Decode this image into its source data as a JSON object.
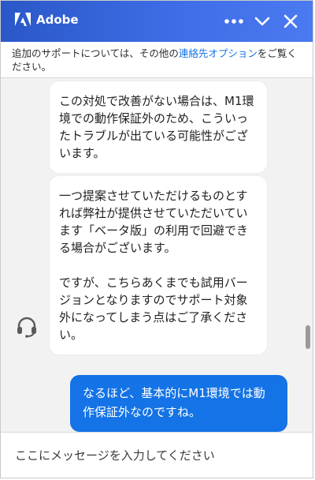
{
  "header": {
    "brand": "Adobe",
    "icons": {
      "logo": "adobe-logo-icon",
      "more": "more-horizontal-icon",
      "minimize": "chevron-down-icon",
      "close": "close-icon"
    }
  },
  "notice": {
    "text_before": "追加のサポートについては、その他の",
    "link": "連絡先オプション",
    "text_after": "をご覧ください。"
  },
  "messages": [
    {
      "role": "agent",
      "paragraphs": [
        "この対処で改善がない場合は、M1環境での動作保証外のため、こういったトラブルが出ている可能性がございます。"
      ]
    },
    {
      "role": "agent",
      "paragraphs": [
        "一つ提案させていただけるものとすれば弊社が提供させていただいています「ベータ版」の利用で回避できる場合がございます。",
        "ですが、こちらあくまでも試用バージョンとなりますのでサポート対象外になってしまう点はご了承ください。"
      ]
    },
    {
      "role": "user",
      "paragraphs": [
        "なるほど、基本的にM1環境では動作保証外なのですね。"
      ]
    }
  ],
  "composer": {
    "placeholder": "ここにメッセージを入力してください"
  },
  "colors": {
    "header": "#3b68e0",
    "accent": "#1473e6",
    "background": "#f2f2f2"
  }
}
